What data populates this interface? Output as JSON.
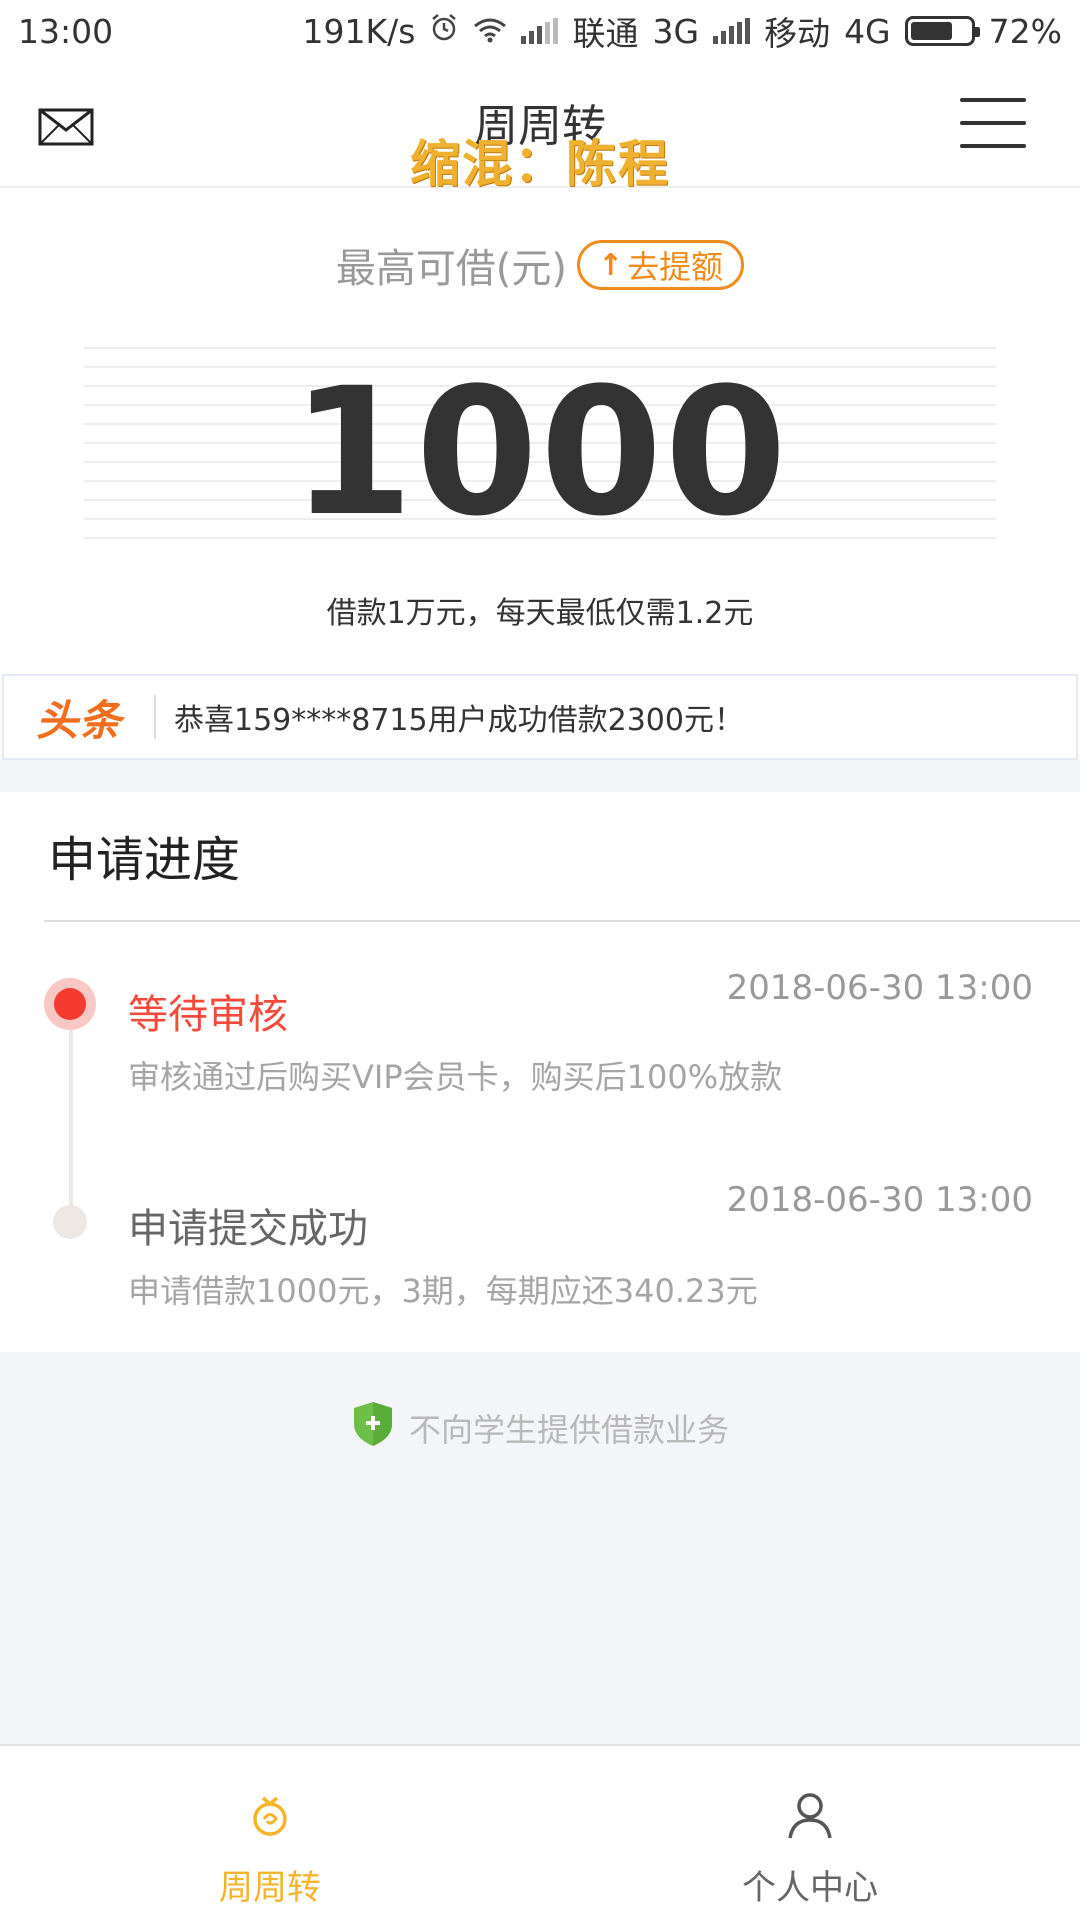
{
  "status_bar": {
    "time": "13:00",
    "speed": "191K/s",
    "carrier1": "联通",
    "network1": "3G",
    "carrier2": "移动",
    "network2": "4G",
    "battery": "72%"
  },
  "header": {
    "title": "周周转",
    "watermark": "缩混：陈程",
    "left_icon": "mail-icon",
    "right_icon": "menu-icon"
  },
  "limit": {
    "label": "最高可借(元)",
    "raise_button": "去提额",
    "amount": "1000",
    "tagline": "借款1万元，每天最低仅需1.2元"
  },
  "ticker": {
    "logo": "头条",
    "message": "恭喜159****8715用户成功借款2300元！"
  },
  "progress": {
    "title": "申请进度",
    "steps": [
      {
        "title": "等待审核",
        "time": "2018-06-30 13:00",
        "desc": "审核通过后购买VIP会员卡，购买后100%放款",
        "active": true
      },
      {
        "title": "申请提交成功",
        "time": "2018-06-30 13:00",
        "desc": "申请借款1000元，3期，每期应还340.23元",
        "active": false
      }
    ]
  },
  "notice": "不向学生提供借款业务",
  "tabs": [
    {
      "label": "周周转",
      "icon": "zhouzhouzhuan-icon",
      "active": true
    },
    {
      "label": "个人中心",
      "icon": "person-icon",
      "active": false
    }
  ],
  "colors": {
    "accent": "#f08b1c",
    "active_tab": "#f4b52a",
    "status_active": "#f43b2f",
    "ticker_logo": "#f06e1d"
  }
}
